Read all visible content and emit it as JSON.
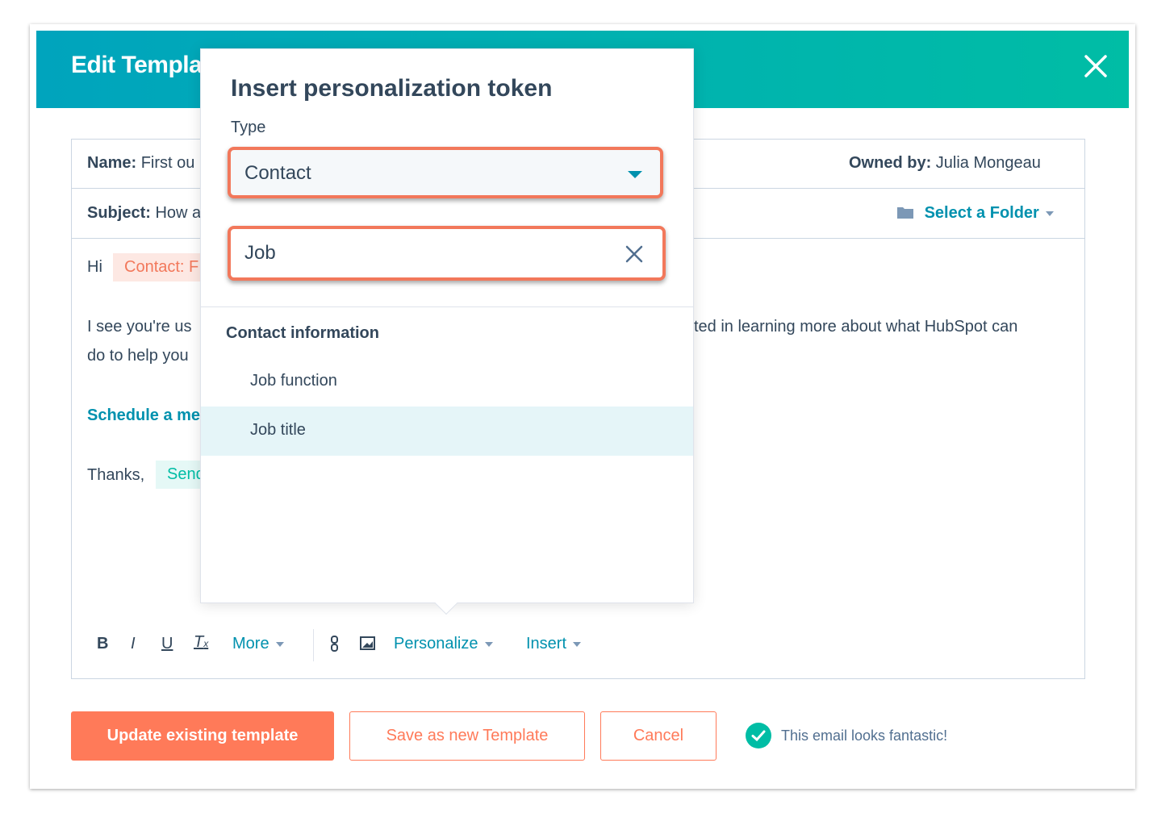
{
  "modal": {
    "title": "Edit Templa",
    "close_icon": "close-icon"
  },
  "fields": {
    "name_label": "Name:",
    "name_value": "First ou",
    "subject_label": "Subject:",
    "subject_value": "How a",
    "owned_label": "Owned by:",
    "owned_value": "Julia Mongeau",
    "folder_label": "Select a Folder"
  },
  "body": {
    "greeting": "Hi",
    "contact_token": "Contact: F",
    "line1_left": "I see you're us",
    "line1_right": "ted in learning more about what HubSpot can",
    "line2_left": "do to help you",
    "link": "Schedule a me",
    "thanks": "Thanks,",
    "sender_token": "Send"
  },
  "popover": {
    "title": "Insert personalization token",
    "type_label": "Type",
    "type_value": "Contact",
    "search_value": "Job",
    "group_header": "Contact information",
    "options": [
      {
        "label": "Job function",
        "highlighted": false
      },
      {
        "label": "Job title",
        "highlighted": true
      }
    ]
  },
  "toolbar": {
    "bold": "B",
    "italic": "I",
    "underline": "U",
    "clear": "T",
    "more": "More",
    "personalize": "Personalize",
    "insert": "Insert"
  },
  "footer": {
    "update": "Update existing template",
    "save_new": "Save as new Template",
    "cancel": "Cancel",
    "status": "This email looks fantastic!"
  },
  "colors": {
    "accent": "#00a4bd",
    "primary": "#ff7a59",
    "link": "#0091ae",
    "success": "#00bda5"
  }
}
